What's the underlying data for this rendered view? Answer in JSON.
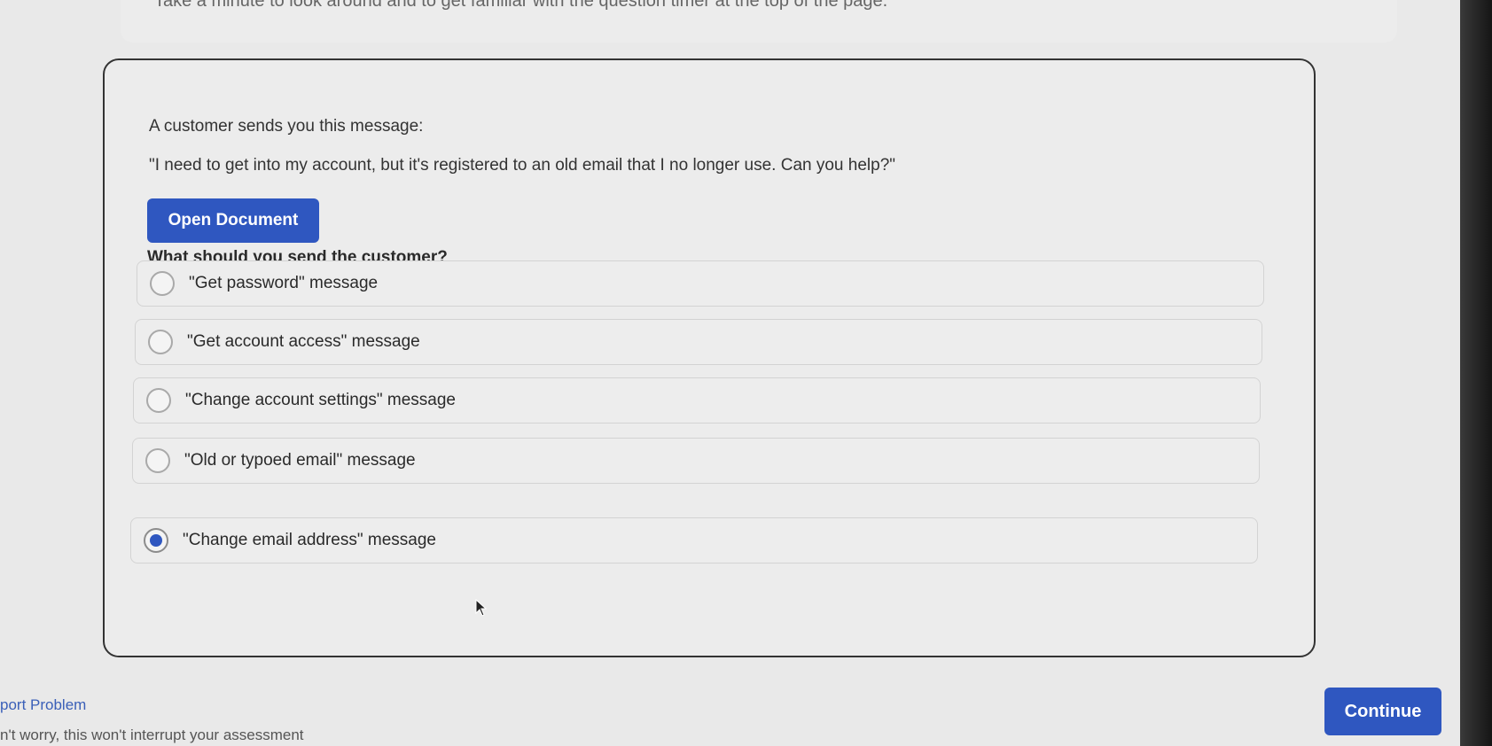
{
  "intro": {
    "text": "Take a minute to look around and to get familiar with the question timer at the top of the page."
  },
  "question_card": {
    "prompt": "A customer sends you this message:",
    "customer_message": "\"I need to get into my account, but it's registered to an old email that I no longer use. Can you help?\"",
    "open_document_label": "Open Document",
    "question": "What should you send the customer?",
    "options": [
      {
        "label": "\"Get password\" message",
        "selected": false
      },
      {
        "label": "\"Get account access\" message",
        "selected": false
      },
      {
        "label": "\"Change account settings\" message",
        "selected": false
      },
      {
        "label": "\"Old or typoed email\" message",
        "selected": false
      },
      {
        "label": "\"Change email address\" message",
        "selected": true
      }
    ]
  },
  "footer": {
    "report_link": "port Problem",
    "report_note": "n't worry, this won't interrupt your assessment",
    "continue_label": "Continue"
  },
  "colors": {
    "accent": "#2f57c0",
    "background": "#e9e9e9"
  },
  "icons": {
    "cursor": "arrow-cursor-icon",
    "radio": "radio-button-icon"
  }
}
